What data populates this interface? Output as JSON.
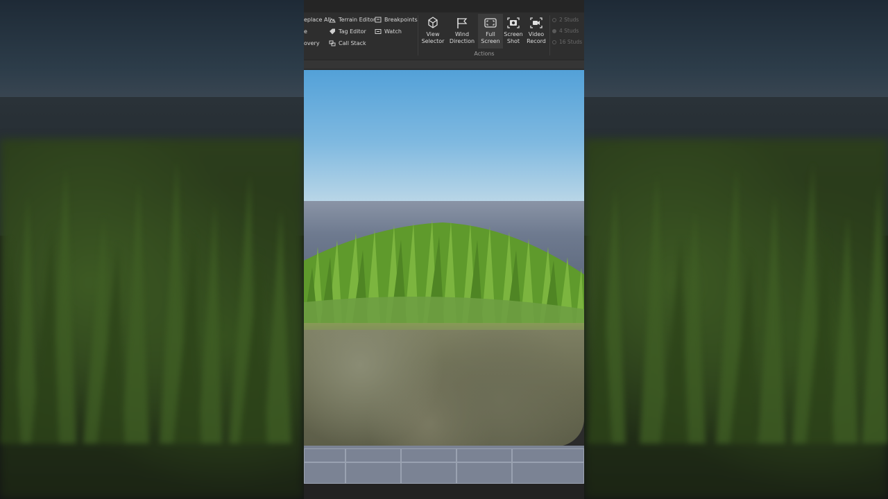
{
  "ribbon": {
    "left_menu": [
      {
        "label": "eplace All",
        "icon": "replace-icon"
      },
      {
        "label": "e",
        "icon": "none"
      },
      {
        "label": "overy",
        "icon": "none"
      }
    ],
    "mid_menu": [
      {
        "label": "Terrain Editor",
        "icon": "terrain-icon"
      },
      {
        "label": "Tag Editor",
        "icon": "tag-icon"
      },
      {
        "label": "Call Stack",
        "icon": "callstack-icon"
      }
    ],
    "debug_menu": [
      {
        "label": "Breakpoints",
        "icon": "breakpoints-icon"
      },
      {
        "label": "Watch",
        "icon": "watch-icon"
      }
    ],
    "actions": [
      {
        "line1": "View",
        "line2": "Selector",
        "icon": "view-selector-icon"
      },
      {
        "line1": "Wind",
        "line2": "Direction",
        "icon": "wind-direction-icon"
      },
      {
        "line1": "Full",
        "line2": "Screen",
        "icon": "full-screen-icon"
      },
      {
        "line1": "Screen",
        "line2": "Shot",
        "icon": "screenshot-icon"
      },
      {
        "line1": "Video",
        "line2": "Record",
        "icon": "video-record-icon"
      }
    ],
    "actions_group_label": "Actions",
    "studs": [
      "2 Studs",
      "4 Studs",
      "16 Studs"
    ]
  },
  "colors": {
    "ribbon_bg": "#2e2e2e",
    "sky_top": "#53a1d8",
    "grass": "#6fa23a"
  }
}
